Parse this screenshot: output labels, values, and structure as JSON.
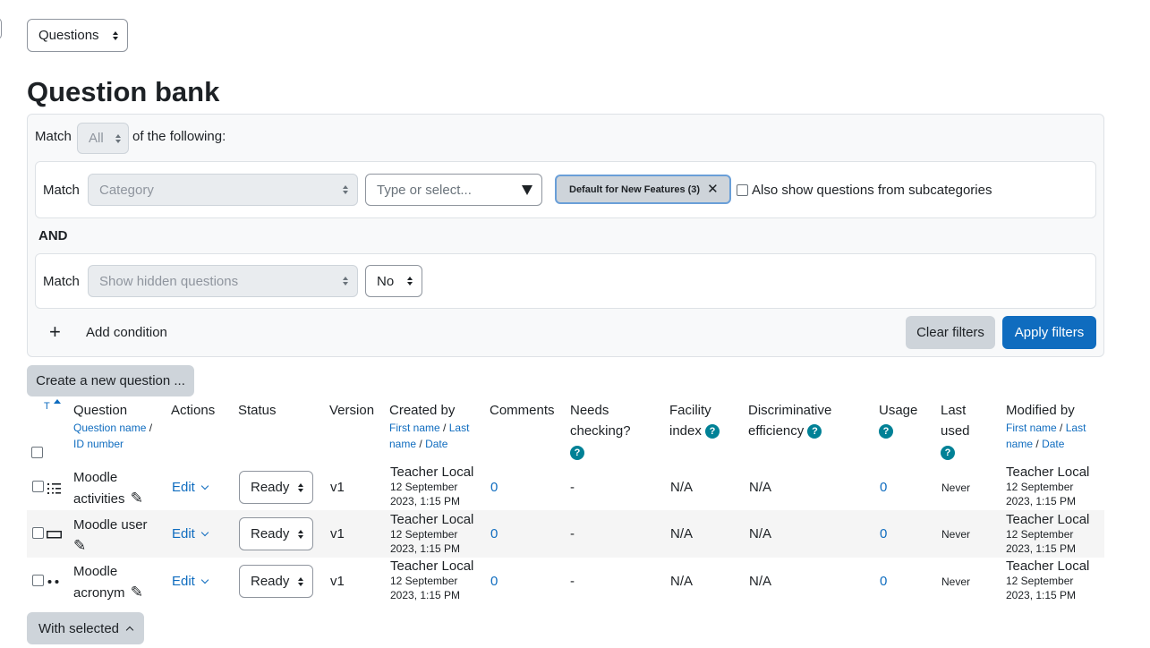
{
  "nav": {
    "selector_value": "Questions"
  },
  "page_title": "Question bank",
  "filters": {
    "match_prefix": "Match",
    "match_all_value": "All",
    "match_suffix": "of the following:",
    "condition1": {
      "match_label": "Match",
      "type_value": "Category",
      "type_placeholder": "Type or select...",
      "chip_label": "Default for New Features (3)",
      "subcategories_label": "Also show questions from subcategories"
    },
    "and_label": "AND",
    "condition2": {
      "match_label": "Match",
      "type_value": "Show hidden questions",
      "value": "No"
    },
    "add_condition": "Add condition",
    "clear_filters": "Clear filters",
    "apply_filters": "Apply filters"
  },
  "create_question_button": "Create a new question ...",
  "table": {
    "headers": {
      "type_sort": "T",
      "question": "Question",
      "question_sub1": "Question name",
      "question_sep": "/",
      "question_sub2": "ID number",
      "actions": "Actions",
      "status": "Status",
      "version": "Version",
      "created_by": "Created by",
      "created_sub1": "First name",
      "created_sep1": "/",
      "created_sub2": "Last name",
      "created_sep2": "/",
      "created_sub3": "Date",
      "comments": "Comments",
      "needs_checking": "Needs checking?",
      "facility_index": "Facility index",
      "discriminative": "Discriminative efficiency",
      "usage": "Usage",
      "last_used": "Last used",
      "modified_by": "Modified by",
      "modified_sub1": "First name",
      "modified_sep1": "/",
      "modified_sub2": "Last name",
      "modified_sep2": "/",
      "modified_sub3": "Date"
    },
    "rows": [
      {
        "type_icon": "multichoice-icon",
        "name_line1": "Moodle",
        "name_line2": "activities",
        "edit": "Edit",
        "status": "Ready",
        "version": "v1",
        "creator": "Teacher Local",
        "created_date1": "12 September",
        "created_date2": "2023, 1:15 PM",
        "comments": "0",
        "needs_checking": "-",
        "facility": "N/A",
        "discriminative": "N/A",
        "usage": "0",
        "last_used": "Never",
        "modifier": "Teacher Local",
        "modified_date1": "12 September",
        "modified_date2": "2023, 1:15 PM"
      },
      {
        "type_icon": "shortanswer-icon",
        "name_line1": "Moodle user",
        "name_line2": "",
        "edit": "Edit",
        "status": "Ready",
        "version": "v1",
        "creator": "Teacher Local",
        "created_date1": "12 September",
        "created_date2": "2023, 1:15 PM",
        "comments": "0",
        "needs_checking": "-",
        "facility": "N/A",
        "discriminative": "N/A",
        "usage": "0",
        "last_used": "Never",
        "modifier": "Teacher Local",
        "modified_date1": "12 September",
        "modified_date2": "2023, 1:15 PM"
      },
      {
        "type_icon": "match-icon",
        "name_line1": "Moodle",
        "name_line2": "acronym",
        "edit": "Edit",
        "status": "Ready",
        "version": "v1",
        "creator": "Teacher Local",
        "created_date1": "12 September",
        "created_date2": "2023, 1:15 PM",
        "comments": "0",
        "needs_checking": "-",
        "facility": "N/A",
        "discriminative": "N/A",
        "usage": "0",
        "last_used": "Never",
        "modifier": "Teacher Local",
        "modified_date1": "12 September",
        "modified_date2": "2023, 1:15 PM"
      }
    ]
  },
  "with_selected_button": "With selected",
  "colors": {
    "primary": "#0f6cbf",
    "help": "#008196",
    "chip_border": "#6a9fd8"
  }
}
